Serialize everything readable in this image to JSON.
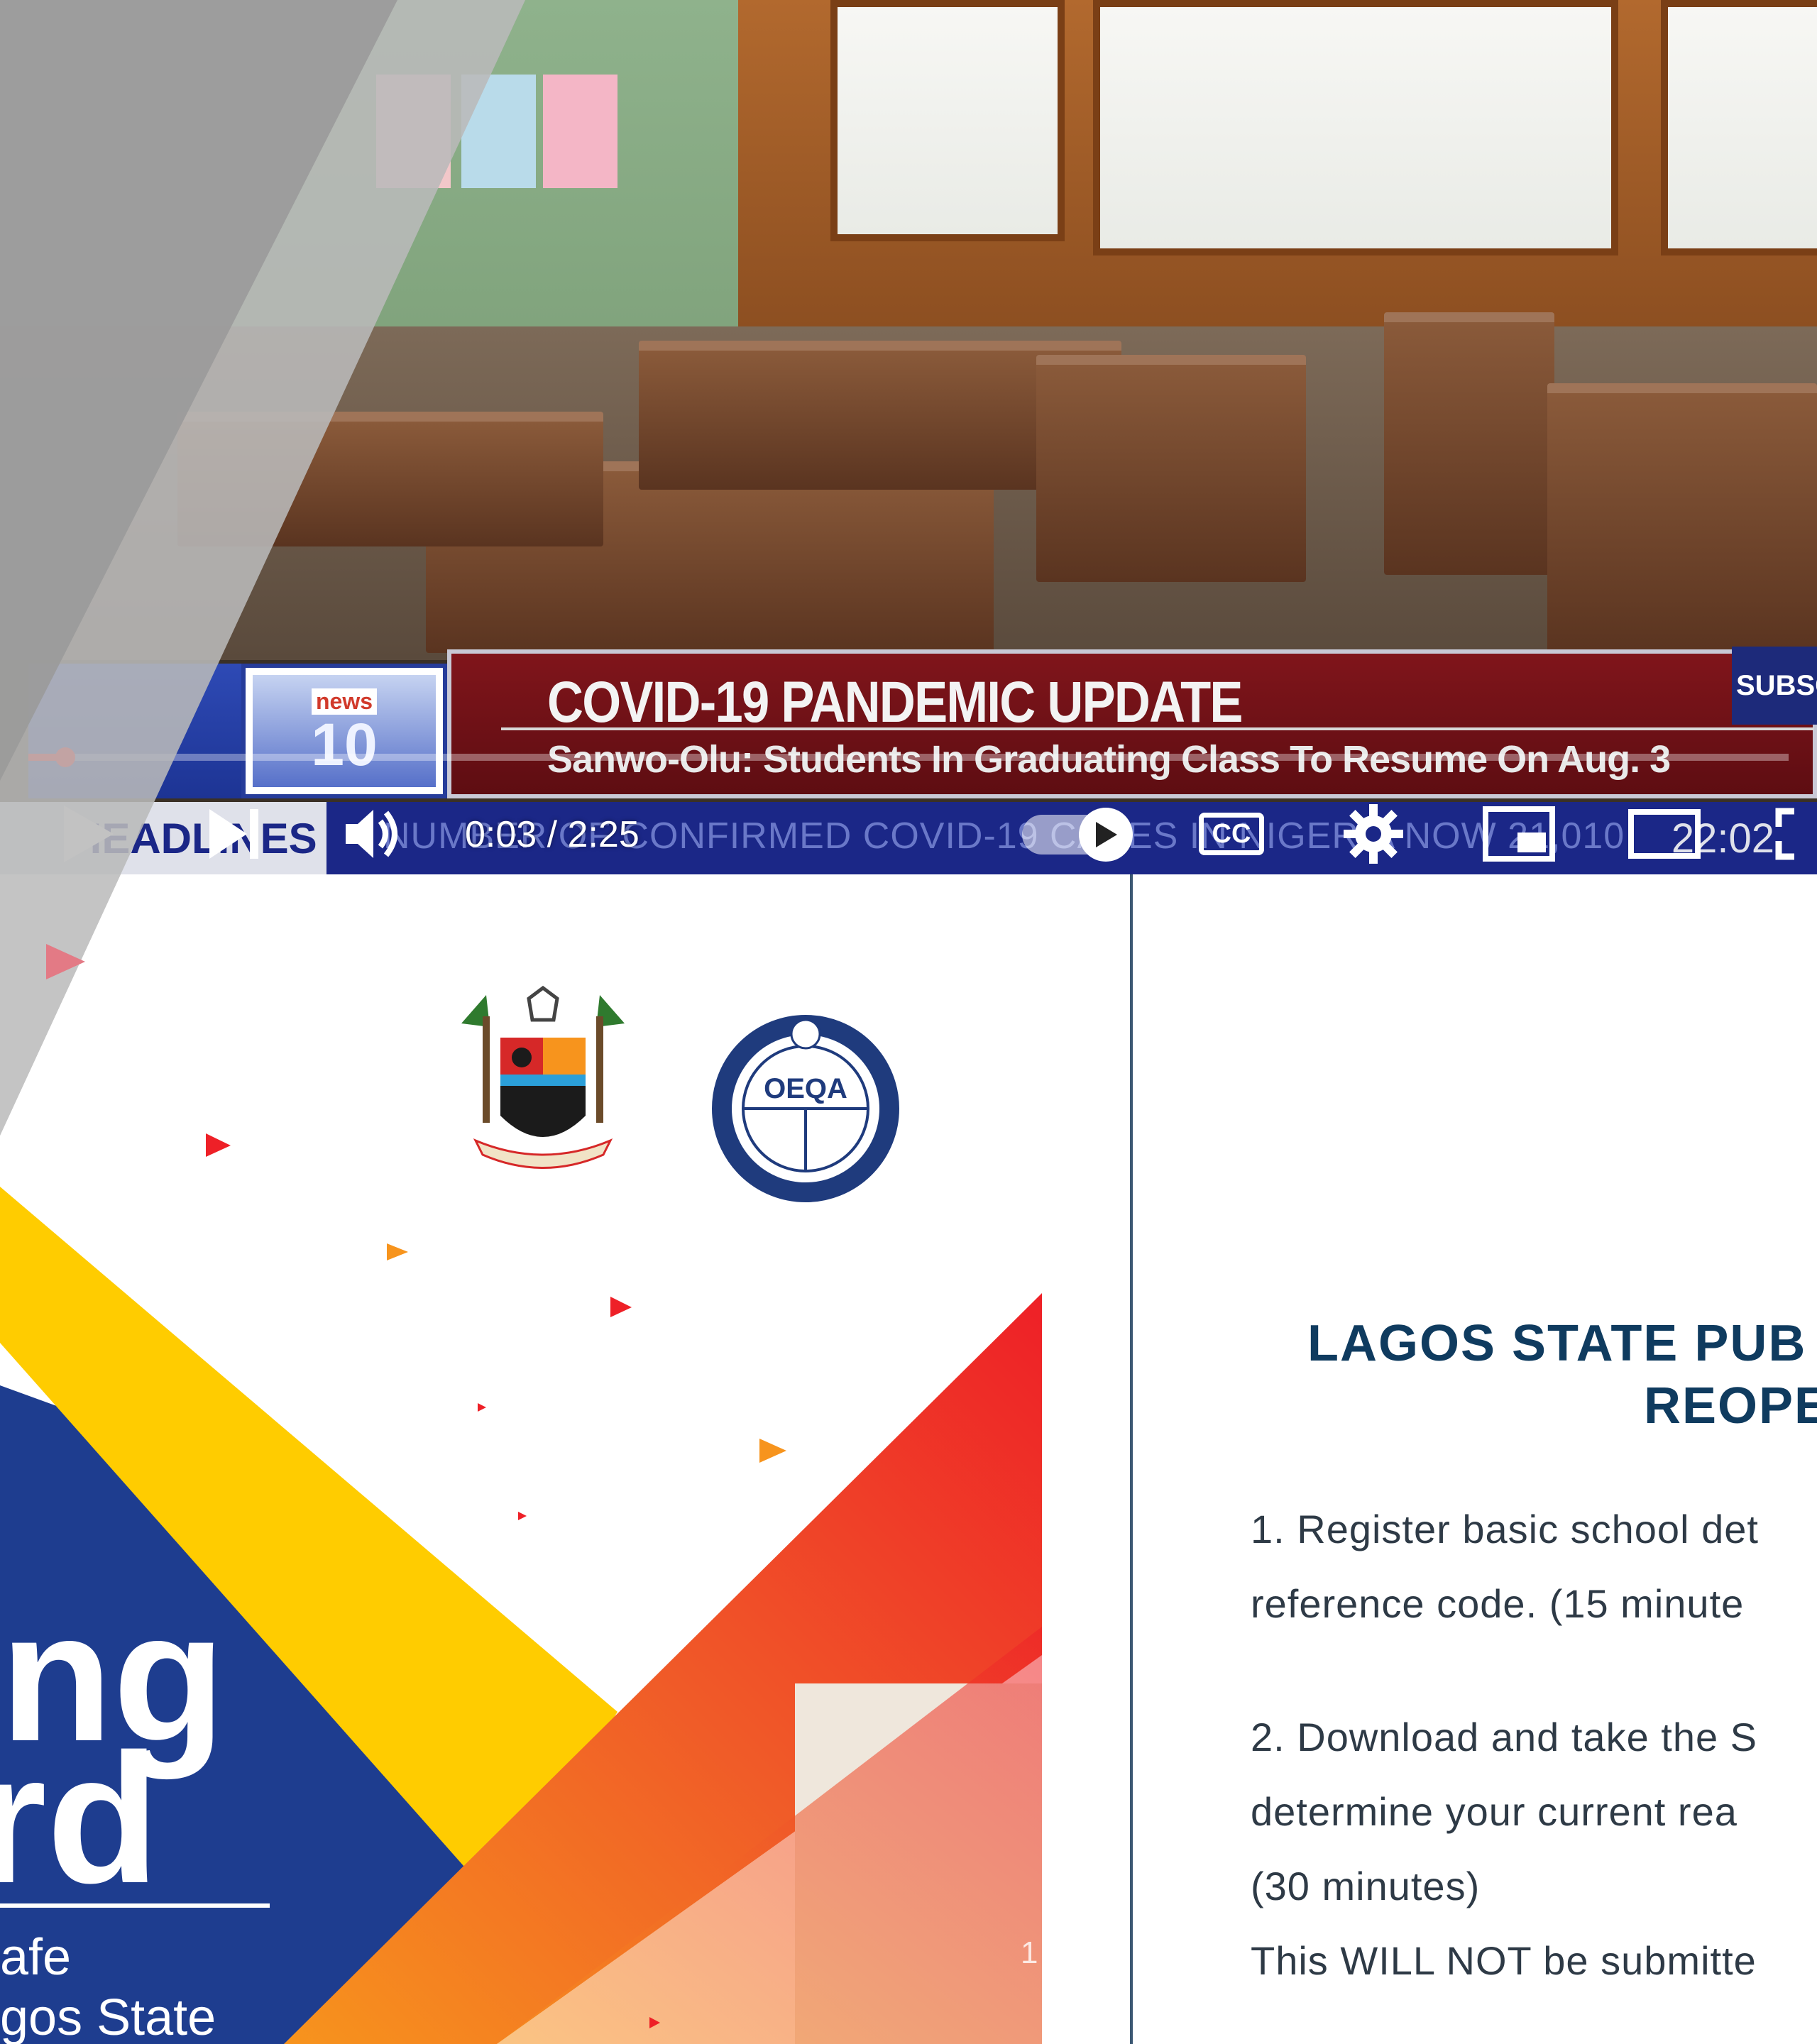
{
  "video": {
    "lower_third": {
      "channel_logo_top": "news",
      "channel_logo_num": "10",
      "title": "COVID-19 PANDEMIC UPDATE",
      "subtitle": "Sanwo-Olu: Students In Graduating Class To Resume On Aug. 3",
      "subscribe_label": "SUBSC"
    },
    "ticker": {
      "head": "HEADLINES",
      "text": "NUMBER OF CONFIRMED COVID-19 CASES IN NIGERIA NOW 21,010",
      "clock": "22:02"
    },
    "controls": {
      "time": "0:03 / 2:25",
      "cc_label": "CC",
      "progress": 0.021
    }
  },
  "slide": {
    "title_line1": "ng",
    "title_line2": "ard",
    "sub_line1": "afe",
    "sub_line2": "gos State",
    "page_number": "1"
  },
  "doc": {
    "title_line1": "LAGOS STATE PUB",
    "title_line2": "REOPE",
    "p1_line1": "1. Register basic school det",
    "p1_line2": "reference code. (15 minute",
    "p2_line1": "2. Download and take the S",
    "p2_line2": "determine your current rea",
    "p2_line3": "(30 minutes)",
    "p3_line1": "This WILL NOT be submitte"
  },
  "colors": {
    "ticker_blue": "#1b2787",
    "lower_third_red": "#80151b",
    "progress_red": "#ff0000",
    "slide_yellow": "#ffcc00",
    "slide_blue": "#1e3d8f",
    "slide_red": "#ee2027",
    "doc_title": "#0f3b5f"
  }
}
